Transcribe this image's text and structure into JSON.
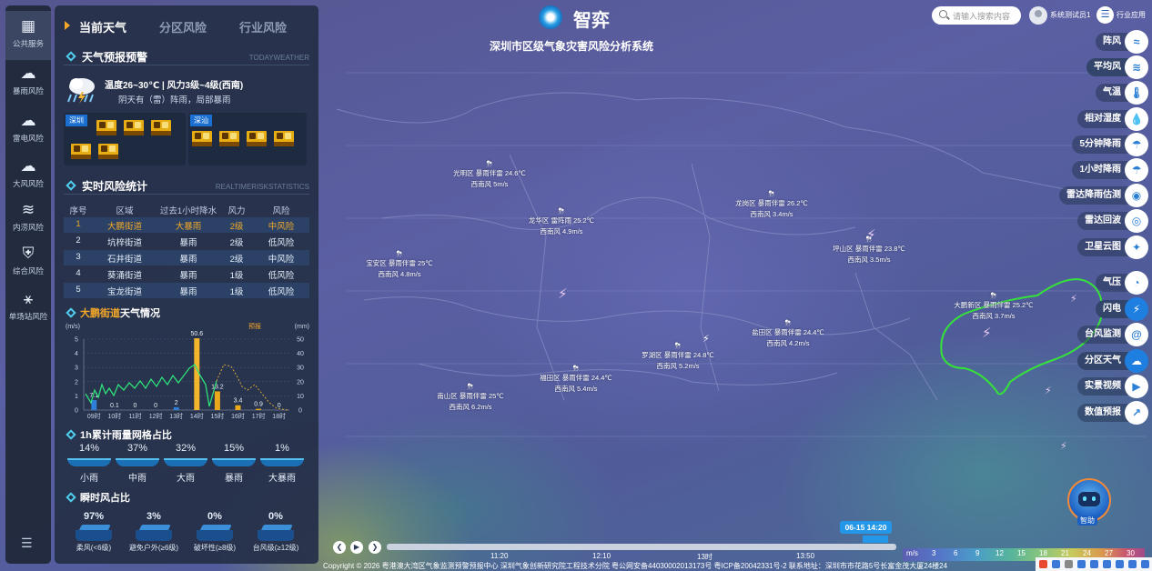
{
  "nav": {
    "items": [
      {
        "label": "公共服务",
        "icon": "book-icon"
      },
      {
        "label": "暴雨风险",
        "icon": "rain-cloud-icon"
      },
      {
        "label": "雷电风险",
        "icon": "thunder-cloud-icon"
      },
      {
        "label": "大风风险",
        "icon": "wind-cloud-icon"
      },
      {
        "label": "内涝风险",
        "icon": "flood-icon"
      },
      {
        "label": "综合风险",
        "icon": "shield-bolt-icon"
      },
      {
        "label": "单场站风险",
        "icon": "turbine-icon"
      }
    ],
    "menu_icon": "menu-icon"
  },
  "tabs": [
    {
      "label": "当前天气"
    },
    {
      "label": "分区风险"
    },
    {
      "label": "行业风险"
    }
  ],
  "forecast": {
    "title": "天气预报预警",
    "en": "TODAYWEATHER",
    "line1": "温度26~30℃ | 风力3级~4级(西南)",
    "line2": "阴天有（雷）阵雨，局部暴雨",
    "regions": [
      {
        "tag": "深圳"
      },
      {
        "tag": "深汕"
      }
    ]
  },
  "stats": {
    "title": "实时风险统计",
    "en": "REALTIMERISKSTATISTICS",
    "headers": [
      "序号",
      "区域",
      "过去1小时降水",
      "风力",
      "风险"
    ],
    "rows": [
      {
        "no": "1",
        "area": "大鹏街道",
        "rain": "大暴雨",
        "wind": "2级",
        "risk": "中风险"
      },
      {
        "no": "2",
        "area": "坑梓街道",
        "rain": "暴雨",
        "wind": "2级",
        "risk": "低风险"
      },
      {
        "no": "3",
        "area": "石井街道",
        "rain": "暴雨",
        "wind": "2级",
        "risk": "中风险"
      },
      {
        "no": "4",
        "area": "葵涌街道",
        "rain": "暴雨",
        "wind": "1级",
        "risk": "低风险"
      },
      {
        "no": "5",
        "area": "宝龙街道",
        "rain": "暴雨",
        "wind": "1级",
        "risk": "低风险"
      }
    ]
  },
  "weather_chart": {
    "title_area": "大鹏街道",
    "title_rest": "天气情况",
    "left_unit": "(m/s)",
    "right_unit": "(mm)",
    "tag": "预报"
  },
  "chart_data": {
    "type": "bar",
    "title": "大鹏街道天气情况",
    "categories": [
      "09时",
      "10时",
      "11时",
      "12时",
      "13时",
      "14时",
      "15时",
      "16时",
      "17时",
      "18时"
    ],
    "values": [
      7.1,
      0.1,
      0,
      0,
      2,
      50.6,
      13.2,
      3.4,
      0.9,
      0
    ],
    "ylabel_left": "(m/s)",
    "ylabel_right": "(mm)",
    "ylim_left": [
      0,
      5
    ],
    "ylim_right": [
      0,
      50
    ],
    "yticks_left": [
      0,
      1,
      2,
      3,
      4,
      5
    ],
    "yticks_right": [
      0,
      10,
      20,
      30,
      40,
      50
    ],
    "forecast_label": "预报"
  },
  "rain_share": {
    "title": "1h累计雨量网格占比",
    "items": [
      {
        "pct": "14%",
        "label": "小雨"
      },
      {
        "pct": "37%",
        "label": "中雨"
      },
      {
        "pct": "32%",
        "label": "大雨"
      },
      {
        "pct": "15%",
        "label": "暴雨"
      },
      {
        "pct": "1%",
        "label": "大暴雨"
      }
    ]
  },
  "wind_share": {
    "title": "瞬时风占比",
    "items": [
      {
        "pct": "97%",
        "label": "柔风(<6级)"
      },
      {
        "pct": "3%",
        "label": "避免户外(≥6级)"
      },
      {
        "pct": "0%",
        "label": "破坏性(≥8级)"
      },
      {
        "pct": "0%",
        "label": "台风级(≥12级)"
      }
    ]
  },
  "header": {
    "logo_text": "智弈",
    "system_title": "深圳市区级气象灾害风险分析系统",
    "search_placeholder": "请输入搜索内容",
    "user": "系统测试员1",
    "industry": "行业应用"
  },
  "tools": [
    {
      "label": "阵风",
      "icon": "gust-icon"
    },
    {
      "label": "平均风",
      "icon": "wind-icon",
      "active": true
    },
    {
      "label": "气温",
      "icon": "thermometer-icon"
    },
    {
      "label": "相对湿度",
      "icon": "humidity-icon"
    },
    {
      "label": "5分钟降雨",
      "icon": "rain-5min-icon"
    },
    {
      "label": "1小时降雨",
      "icon": "rain-1h-icon"
    },
    {
      "label": "雷达降雨估测",
      "icon": "radar-rain-icon"
    },
    {
      "label": "雷达回波",
      "icon": "radar-echo-icon"
    },
    {
      "label": "卫星云图",
      "icon": "satellite-icon"
    },
    {
      "label": "气压",
      "icon": "gauge-icon"
    },
    {
      "label": "闪电",
      "icon": "lightning-icon",
      "active": true
    },
    {
      "label": "台风监测",
      "icon": "typhoon-icon"
    },
    {
      "label": "分区天气",
      "icon": "cloud-icon",
      "active": true
    },
    {
      "label": "实景视频",
      "icon": "video-icon"
    },
    {
      "label": "数值预报",
      "icon": "chart-icon"
    }
  ],
  "assistant": {
    "name": "智助"
  },
  "districts": [
    {
      "l1": "光明区 暴雨伴雷 24.6℃",
      "l2": "西南风 5m/s"
    },
    {
      "l1": "龙华区 雷阵雨 25.2℃",
      "l2": "西南风 4.9m/s"
    },
    {
      "l1": "龙岗区 暴雨伴雷 26.2℃",
      "l2": "西南风 3.4m/s"
    },
    {
      "l1": "坪山区 暴雨伴雷 23.8℃",
      "l2": "西南风 3.5m/s"
    },
    {
      "l1": "宝安区 暴雨伴雷 25℃",
      "l2": "西南风 4.8m/s"
    },
    {
      "l1": "大鹏新区 暴雨伴雷 25.2℃",
      "l2": "西南风 3.7m/s"
    },
    {
      "l1": "盐田区 暴雨伴雷 24.4℃",
      "l2": "西南风 4.2m/s"
    },
    {
      "l1": "罗湖区 暴雨伴雷 24.8℃",
      "l2": "西南风 5.2m/s"
    },
    {
      "l1": "福田区 暴雨伴雷 24.4℃",
      "l2": "西南风 5.4m/s"
    },
    {
      "l1": "南山区 暴雨伴雷 25℃",
      "l2": "西南风 6.2m/s"
    }
  ],
  "timeline": {
    "current": "06-15 14:20",
    "ticks": [
      "11:20",
      "12:10",
      "13时",
      "13:50"
    ]
  },
  "legend": {
    "unit": "m/s",
    "values": [
      "3",
      "6",
      "9",
      "12",
      "15",
      "18",
      "21",
      "24",
      "27",
      "30"
    ]
  },
  "footer": {
    "copyright": "Copyright © 2026 粤港澳大湾区气象监测预警预报中心 深圳气象创新研究院工程技术分院  粤公网安备44030002013173号  粤ICP备20042331号-2  联系地址：深圳市市花路5号长富金茂大厦24楼24"
  }
}
